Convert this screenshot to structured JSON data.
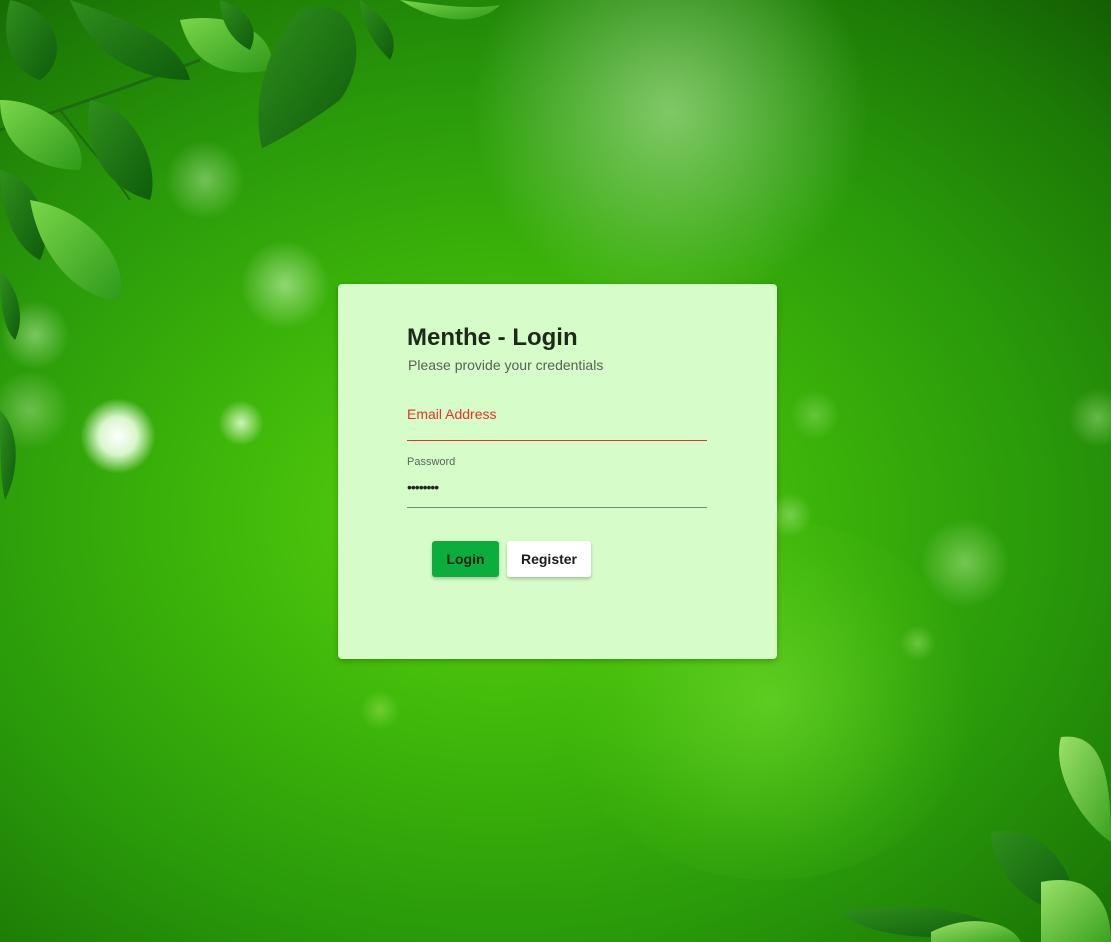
{
  "colors": {
    "card_background": "#d5fcc9",
    "accent_primary": "#0bae3c",
    "error_red": "#e8332b",
    "background_green": "#3fb80a"
  },
  "login_card": {
    "title": "Menthe - Login",
    "subtitle": "Please provide your credentials",
    "email_field": {
      "label": "Email Address",
      "value": "",
      "state": "error"
    },
    "password_field": {
      "label": "Password",
      "value_masked": "••••••••"
    },
    "login_button_label": "Login",
    "register_button_label": "Register"
  },
  "background": {
    "image": "green-leaves-bokeh"
  }
}
